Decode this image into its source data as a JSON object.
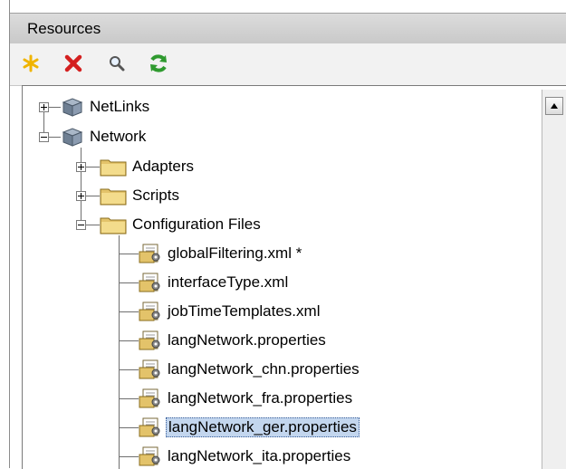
{
  "panel": {
    "title": "Resources"
  },
  "toolbar": {
    "buttons": [
      {
        "name": "new",
        "icon": "asterisk-icon",
        "color": "#f0b400"
      },
      {
        "name": "delete",
        "icon": "x-icon",
        "color": "#d42020"
      },
      {
        "name": "find",
        "icon": "magnifier-icon",
        "color": "#555555"
      },
      {
        "name": "refresh",
        "icon": "refresh-icon",
        "color": "#2f9a2f"
      }
    ]
  },
  "tree": {
    "root_nodes": [
      {
        "label": "NetLinks",
        "icon": "package-icon",
        "expanded": false
      },
      {
        "label": "Network",
        "icon": "package-icon",
        "expanded": true
      }
    ],
    "folders": [
      {
        "label": "Adapters",
        "icon": "folder-icon",
        "expanded": false
      },
      {
        "label": "Scripts",
        "icon": "folder-icon",
        "expanded": false
      },
      {
        "label": "Configuration Files",
        "icon": "folder-icon",
        "expanded": true
      }
    ],
    "files": [
      {
        "label": "globalFiltering.xml *",
        "icon": "config-file-icon"
      },
      {
        "label": "interfaceType.xml",
        "icon": "config-file-icon"
      },
      {
        "label": "jobTimeTemplates.xml",
        "icon": "config-file-icon"
      },
      {
        "label": "langNetwork.properties",
        "icon": "config-file-icon"
      },
      {
        "label": "langNetwork_chn.properties",
        "icon": "config-file-icon"
      },
      {
        "label": "langNetwork_fra.properties",
        "icon": "config-file-icon"
      },
      {
        "label": "langNetwork_ger.properties",
        "icon": "config-file-icon",
        "selected": true
      },
      {
        "label": "langNetwork_ita.properties",
        "icon": "config-file-icon"
      }
    ],
    "selection_color": "#c3d6ee"
  }
}
